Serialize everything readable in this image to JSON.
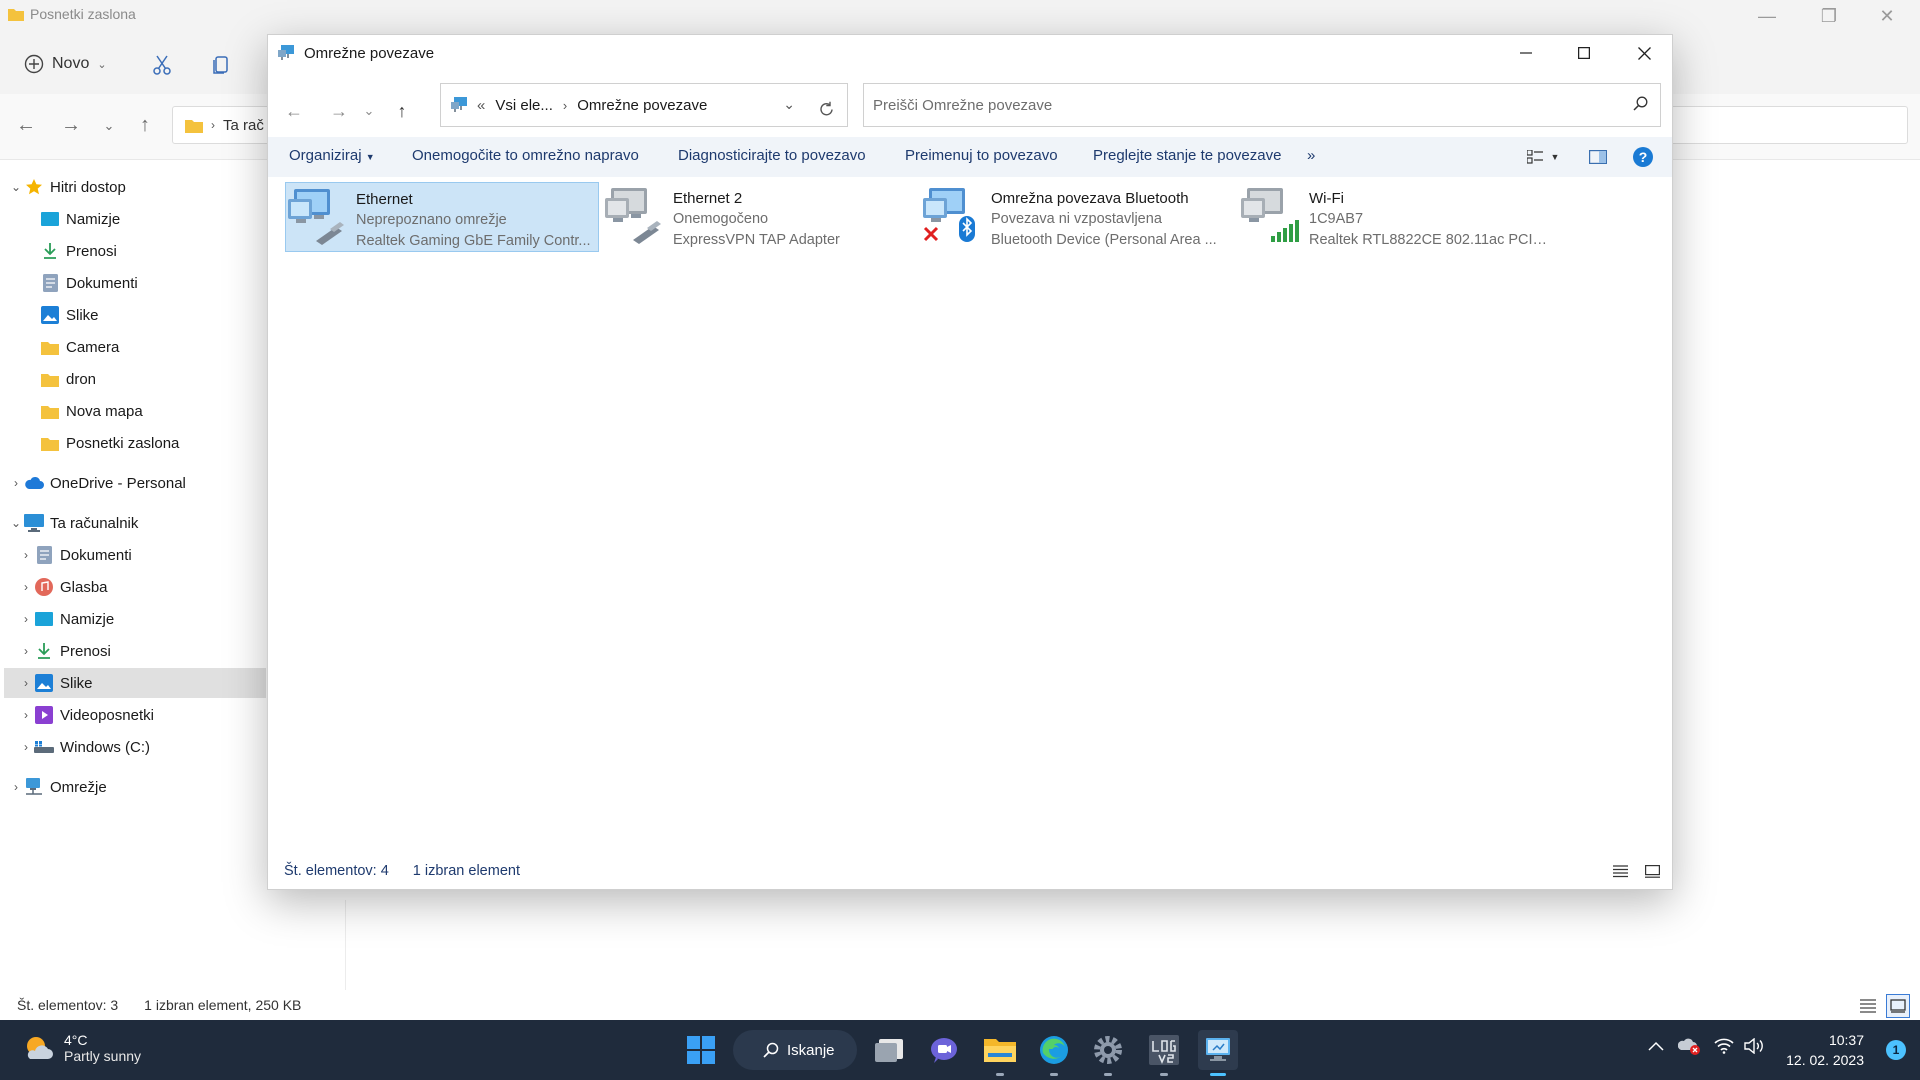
{
  "background_window": {
    "title": "Posnetki zaslona",
    "new_button": "Novo",
    "address_text": "Ta rač",
    "status_count": "Št. elementov: 3",
    "status_selection": "1 izbran element, 250 KB"
  },
  "sidebar": {
    "quick_access": "Hitri dostop",
    "quick_items": [
      "Namizje",
      "Prenosi",
      "Dokumenti",
      "Slike",
      "Camera",
      "dron",
      "Nova mapa",
      "Posnetki zaslona"
    ],
    "onedrive": "OneDrive - Personal",
    "this_pc": "Ta računalnik",
    "pc_items": [
      "Dokumenti",
      "Glasba",
      "Namizje",
      "Prenosi",
      "Slike",
      "Videoposnetki",
      "Windows (C:)"
    ],
    "network": "Omrežje"
  },
  "dialog": {
    "title": "Omrežne povezave",
    "breadcrumb_prefix": "«",
    "breadcrumb_parent": "Vsi ele...",
    "breadcrumb_current": "Omrežne povezave",
    "search_placeholder": "Preišči Omrežne povezave",
    "commands": [
      "Organiziraj",
      "Onemogočite to omrežno napravo",
      "Diagnosticirajte to povezavo",
      "Preimenuj to povezavo",
      "Preglejte stanje te povezave"
    ],
    "more_commands": "»",
    "help": "?",
    "items": [
      {
        "name": "Ethernet",
        "status": "Neprepoznano omrežje",
        "device": "Realtek Gaming GbE Family Contr..."
      },
      {
        "name": "Ethernet 2",
        "status": "Onemogočeno",
        "device": "ExpressVPN TAP Adapter"
      },
      {
        "name": "Omrežna povezava Bluetooth",
        "status": "Povezava ni vzpostavljena",
        "device": "Bluetooth Device (Personal Area ..."
      },
      {
        "name": "Wi-Fi",
        "status": "1C9AB7",
        "device": "Realtek RTL8822CE 802.11ac PCIe ..."
      }
    ],
    "status_count": "Št. elementov: 4",
    "status_selection": "1 izbran element"
  },
  "taskbar": {
    "temperature": "4°C",
    "weather": "Partly sunny",
    "search_label": "Iskanje",
    "time": "10:37",
    "date": "12. 02. 2023",
    "notification_count": "1"
  },
  "colors": {
    "accent": "#0067c0",
    "selection": "#cce4f7",
    "taskbar": "#1f2b3c",
    "command_bar": "#f0f4f9"
  }
}
